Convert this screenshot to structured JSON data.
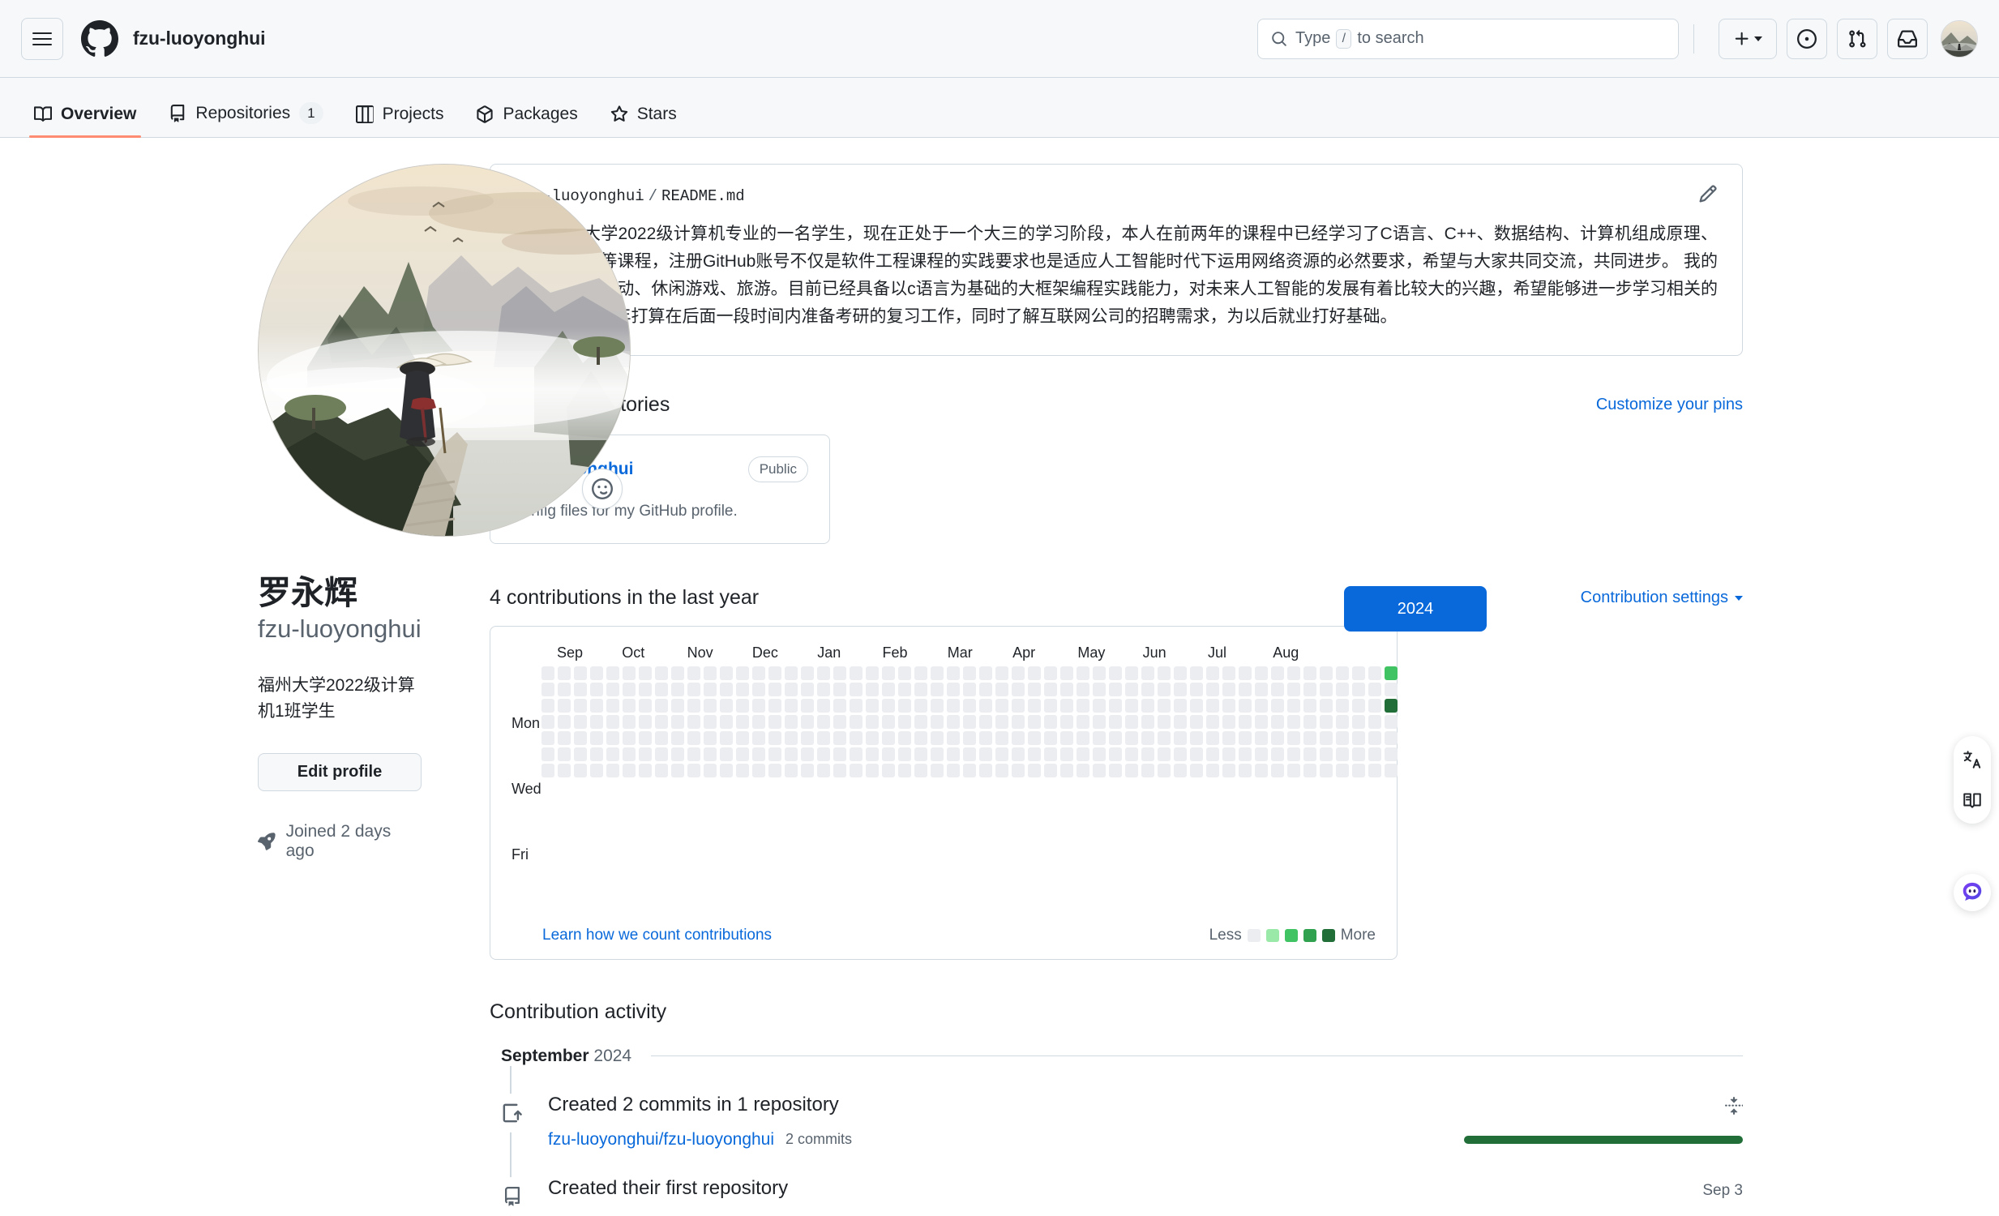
{
  "header": {
    "owner": "fzu-luoyonghui",
    "search_placeholder": "Type",
    "search_key": "/",
    "search_suffix": "to search",
    "icons": {
      "menu": "hamburger-icon",
      "logo": "github-logo-icon",
      "create": "plus-icon",
      "issues": "issue-opened-icon",
      "pulls": "git-pull-request-icon",
      "inbox": "inbox-icon",
      "avatar": "user-avatar"
    }
  },
  "nav": {
    "tabs": [
      {
        "label": "Overview",
        "icon": "book-icon",
        "active": true,
        "count": null
      },
      {
        "label": "Repositories",
        "icon": "repo-icon",
        "active": false,
        "count": "1"
      },
      {
        "label": "Projects",
        "icon": "table-icon",
        "active": false,
        "count": null
      },
      {
        "label": "Packages",
        "icon": "package-icon",
        "active": false,
        "count": null
      },
      {
        "label": "Stars",
        "icon": "star-icon",
        "active": false,
        "count": null
      }
    ]
  },
  "profile": {
    "fullname": "罗永辉",
    "login": "fzu-luoyonghui",
    "bio": "福州大学2022级计算机1班学生",
    "edit_button": "Edit profile",
    "joined": "Joined 2 days ago",
    "status_icon": "smiley-icon",
    "joined_icon": "rocket-icon"
  },
  "readme": {
    "owner": "fzu-luoyonghui",
    "separator": "/",
    "file": "README.md",
    "edit_icon": "pencil-icon",
    "body": "我是福州大学2022级计算机专业的一名学生，现在正处于一个大三的学习阶段，本人在前两年的课程中已经学习了C语言、C++、数据结构、计算机组成原理、计算机网络等课程，注册GitHub账号不仅是软件工程课程的实践要求也是适应人工智能时代下运用网络资源的必然要求，希望与大家共同交流，共同进步。 我的兴趣爱好是运动、休闲游戏、旅游。目前已经具备以c语言为基础的大框架编程实践能力，对未来人工智能的发展有着比较大的兴趣，希望能够进一步学习相关的知识。 未来3年打算在后面一段时间内准备考研的复习工作，同时了解互联网公司的招聘需求，为以后就业打好基础。"
  },
  "popular": {
    "title": "Popular repositories",
    "customize_link": "Customize your pins",
    "repos": [
      {
        "name": "fzu-luoyonghui",
        "visibility": "Public",
        "description": "Config files for my GitHub profile."
      }
    ]
  },
  "contributions": {
    "title": "4 contributions in the last year",
    "settings_label": "Contribution settings",
    "year_button": "2024",
    "months": [
      "Sep",
      "Oct",
      "Nov",
      "Dec",
      "Jan",
      "Feb",
      "Mar",
      "Apr",
      "May",
      "Jun",
      "Jul",
      "Aug"
    ],
    "days": [
      "Mon",
      "Wed",
      "Fri"
    ],
    "learn_link": "Learn how we count contributions",
    "legend_less": "Less",
    "legend_more": "More",
    "legend_colors": [
      "#ebedf0",
      "#9be9a8",
      "#40c463",
      "#30a14e",
      "#216e39"
    ],
    "weeks": 53,
    "rows": 7,
    "filled_cells": [
      {
        "week": 52,
        "day": 0,
        "level": 2
      },
      {
        "week": 52,
        "day": 2,
        "level": 4
      }
    ]
  },
  "activity": {
    "title": "Contribution activity",
    "month_bold": "September",
    "month_year": "2024",
    "items": [
      {
        "icon": "commit-icon",
        "heading": "Created 2 commits in 1 repository",
        "repo": "fzu-luoyonghui/fzu-luoyonghui",
        "commits": "2 commits",
        "has_bar": true,
        "collapse_icon": "fold-icon",
        "date": null
      },
      {
        "icon": "repo-icon",
        "heading": "Created their first repository",
        "repo": null,
        "commits": null,
        "has_bar": false,
        "collapse_icon": null,
        "date": "Sep 3"
      }
    ]
  },
  "rail": {
    "translate_icon": "translate-icon",
    "read_icon": "read-mode-icon",
    "assistant_icon": "ai-assistant-icon"
  },
  "colors": {
    "accent_blue": "#0969da",
    "tab_underline": "#fd8c73",
    "contrib_dark": "#216e39",
    "header_bg": "#f6f8fa",
    "border": "#d1d9e0"
  }
}
